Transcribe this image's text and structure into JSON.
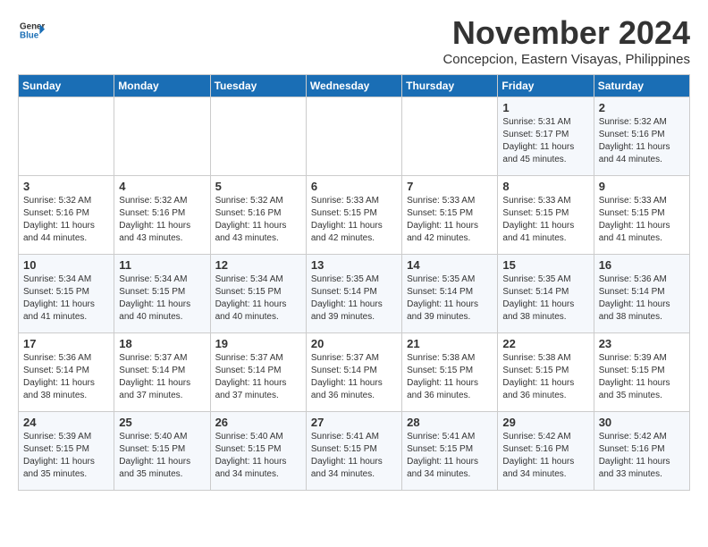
{
  "header": {
    "logo_line1": "General",
    "logo_line2": "Blue",
    "month": "November 2024",
    "location": "Concepcion, Eastern Visayas, Philippines"
  },
  "weekdays": [
    "Sunday",
    "Monday",
    "Tuesday",
    "Wednesday",
    "Thursday",
    "Friday",
    "Saturday"
  ],
  "weeks": [
    [
      {
        "day": "",
        "text": ""
      },
      {
        "day": "",
        "text": ""
      },
      {
        "day": "",
        "text": ""
      },
      {
        "day": "",
        "text": ""
      },
      {
        "day": "",
        "text": ""
      },
      {
        "day": "1",
        "text": "Sunrise: 5:31 AM\nSunset: 5:17 PM\nDaylight: 11 hours\nand 45 minutes."
      },
      {
        "day": "2",
        "text": "Sunrise: 5:32 AM\nSunset: 5:16 PM\nDaylight: 11 hours\nand 44 minutes."
      }
    ],
    [
      {
        "day": "3",
        "text": "Sunrise: 5:32 AM\nSunset: 5:16 PM\nDaylight: 11 hours\nand 44 minutes."
      },
      {
        "day": "4",
        "text": "Sunrise: 5:32 AM\nSunset: 5:16 PM\nDaylight: 11 hours\nand 43 minutes."
      },
      {
        "day": "5",
        "text": "Sunrise: 5:32 AM\nSunset: 5:16 PM\nDaylight: 11 hours\nand 43 minutes."
      },
      {
        "day": "6",
        "text": "Sunrise: 5:33 AM\nSunset: 5:15 PM\nDaylight: 11 hours\nand 42 minutes."
      },
      {
        "day": "7",
        "text": "Sunrise: 5:33 AM\nSunset: 5:15 PM\nDaylight: 11 hours\nand 42 minutes."
      },
      {
        "day": "8",
        "text": "Sunrise: 5:33 AM\nSunset: 5:15 PM\nDaylight: 11 hours\nand 41 minutes."
      },
      {
        "day": "9",
        "text": "Sunrise: 5:33 AM\nSunset: 5:15 PM\nDaylight: 11 hours\nand 41 minutes."
      }
    ],
    [
      {
        "day": "10",
        "text": "Sunrise: 5:34 AM\nSunset: 5:15 PM\nDaylight: 11 hours\nand 41 minutes."
      },
      {
        "day": "11",
        "text": "Sunrise: 5:34 AM\nSunset: 5:15 PM\nDaylight: 11 hours\nand 40 minutes."
      },
      {
        "day": "12",
        "text": "Sunrise: 5:34 AM\nSunset: 5:15 PM\nDaylight: 11 hours\nand 40 minutes."
      },
      {
        "day": "13",
        "text": "Sunrise: 5:35 AM\nSunset: 5:14 PM\nDaylight: 11 hours\nand 39 minutes."
      },
      {
        "day": "14",
        "text": "Sunrise: 5:35 AM\nSunset: 5:14 PM\nDaylight: 11 hours\nand 39 minutes."
      },
      {
        "day": "15",
        "text": "Sunrise: 5:35 AM\nSunset: 5:14 PM\nDaylight: 11 hours\nand 38 minutes."
      },
      {
        "day": "16",
        "text": "Sunrise: 5:36 AM\nSunset: 5:14 PM\nDaylight: 11 hours\nand 38 minutes."
      }
    ],
    [
      {
        "day": "17",
        "text": "Sunrise: 5:36 AM\nSunset: 5:14 PM\nDaylight: 11 hours\nand 38 minutes."
      },
      {
        "day": "18",
        "text": "Sunrise: 5:37 AM\nSunset: 5:14 PM\nDaylight: 11 hours\nand 37 minutes."
      },
      {
        "day": "19",
        "text": "Sunrise: 5:37 AM\nSunset: 5:14 PM\nDaylight: 11 hours\nand 37 minutes."
      },
      {
        "day": "20",
        "text": "Sunrise: 5:37 AM\nSunset: 5:14 PM\nDaylight: 11 hours\nand 36 minutes."
      },
      {
        "day": "21",
        "text": "Sunrise: 5:38 AM\nSunset: 5:15 PM\nDaylight: 11 hours\nand 36 minutes."
      },
      {
        "day": "22",
        "text": "Sunrise: 5:38 AM\nSunset: 5:15 PM\nDaylight: 11 hours\nand 36 minutes."
      },
      {
        "day": "23",
        "text": "Sunrise: 5:39 AM\nSunset: 5:15 PM\nDaylight: 11 hours\nand 35 minutes."
      }
    ],
    [
      {
        "day": "24",
        "text": "Sunrise: 5:39 AM\nSunset: 5:15 PM\nDaylight: 11 hours\nand 35 minutes."
      },
      {
        "day": "25",
        "text": "Sunrise: 5:40 AM\nSunset: 5:15 PM\nDaylight: 11 hours\nand 35 minutes."
      },
      {
        "day": "26",
        "text": "Sunrise: 5:40 AM\nSunset: 5:15 PM\nDaylight: 11 hours\nand 34 minutes."
      },
      {
        "day": "27",
        "text": "Sunrise: 5:41 AM\nSunset: 5:15 PM\nDaylight: 11 hours\nand 34 minutes."
      },
      {
        "day": "28",
        "text": "Sunrise: 5:41 AM\nSunset: 5:15 PM\nDaylight: 11 hours\nand 34 minutes."
      },
      {
        "day": "29",
        "text": "Sunrise: 5:42 AM\nSunset: 5:16 PM\nDaylight: 11 hours\nand 34 minutes."
      },
      {
        "day": "30",
        "text": "Sunrise: 5:42 AM\nSunset: 5:16 PM\nDaylight: 11 hours\nand 33 minutes."
      }
    ]
  ]
}
